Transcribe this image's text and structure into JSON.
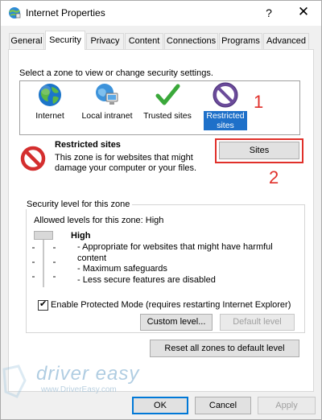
{
  "window": {
    "title": "Internet Properties",
    "help_label": "?",
    "close_label": "✕"
  },
  "tabs": [
    {
      "label": "General"
    },
    {
      "label": "Security"
    },
    {
      "label": "Privacy"
    },
    {
      "label": "Content"
    },
    {
      "label": "Connections"
    },
    {
      "label": "Programs"
    },
    {
      "label": "Advanced"
    }
  ],
  "active_tab": "Security",
  "security": {
    "zone_prompt": "Select a zone to view or change security settings.",
    "zones": [
      {
        "label": "Internet",
        "icon": "globe-icon"
      },
      {
        "label": "Local intranet",
        "icon": "network-icon"
      },
      {
        "label": "Trusted sites",
        "icon": "checkmark-icon"
      },
      {
        "label_line1": "Restricted",
        "label_line2": "sites",
        "icon": "restricted-icon",
        "selected": true
      }
    ],
    "selected_zone": {
      "title": "Restricted sites",
      "description": "This zone is for websites that might damage your computer or your files."
    },
    "sites_button": "Sites",
    "level_group_title": "Security level for this zone",
    "allowed_levels": "Allowed levels for this zone: High",
    "level_name": "High",
    "level_points": [
      "- Appropriate for websites that might have harmful content",
      "- Maximum safeguards",
      "- Less secure features are disabled"
    ],
    "protected_mode_label": "Enable Protected Mode (requires restarting Internet Explorer)",
    "protected_mode_checked": true,
    "custom_level_button": "Custom level...",
    "default_level_button": "Default level",
    "reset_all_button": "Reset all zones to default level"
  },
  "footer": {
    "ok": "OK",
    "cancel": "Cancel",
    "apply": "Apply"
  },
  "annotations": {
    "one": "1",
    "two": "2"
  },
  "watermark": {
    "text": "driver easy",
    "url": "www.DriverEasy.com"
  },
  "colors": {
    "selection": "#1e70c9",
    "annotation": "#e0302a"
  }
}
